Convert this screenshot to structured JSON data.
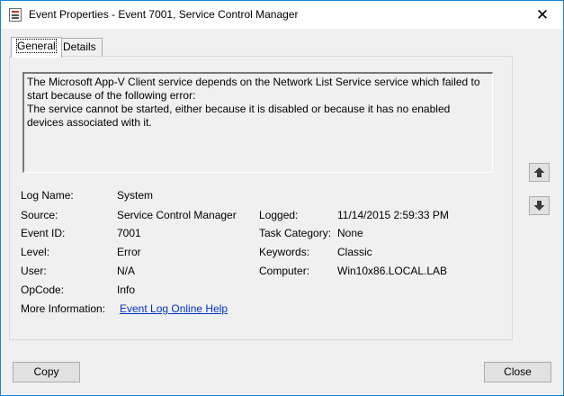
{
  "window": {
    "title": "Event Properties - Event 7001, Service Control Manager",
    "close_glyph": "✕"
  },
  "tabs": [
    {
      "label": "General",
      "active": true
    },
    {
      "label": "Details",
      "active": false
    }
  ],
  "description": {
    "line1": "The Microsoft App-V Client service depends on the Network List Service service which failed to start because of the following error:",
    "line2": "The service cannot be started, either because it is disabled or because it has no enabled devices associated with it."
  },
  "fields": {
    "log_name": {
      "label": "Log Name:",
      "value": "System"
    },
    "source": {
      "label": "Source:",
      "value": "Service Control Manager"
    },
    "logged": {
      "label": "Logged:",
      "value": "11/14/2015 2:59:33 PM"
    },
    "event_id": {
      "label": "Event ID:",
      "value": "7001"
    },
    "task_category": {
      "label": "Task Category:",
      "value": "None"
    },
    "level": {
      "label": "Level:",
      "value": "Error"
    },
    "keywords": {
      "label": "Keywords:",
      "value": "Classic"
    },
    "user": {
      "label": "User:",
      "value": "N/A"
    },
    "computer": {
      "label": "Computer:",
      "value": "Win10x86.LOCAL.LAB"
    },
    "opcode": {
      "label": "OpCode:",
      "value": "Info"
    },
    "more_info": {
      "label": "More Information:",
      "link": "Event Log Online Help"
    }
  },
  "buttons": {
    "copy": "Copy",
    "close": "Close"
  },
  "icons": {
    "app": "event-viewer-icon",
    "up": "arrow-up-icon",
    "down": "arrow-down-icon"
  },
  "colors": {
    "window_border": "#1883d7",
    "dialog_bg": "#f0f0f0",
    "link": "#0033cc"
  }
}
